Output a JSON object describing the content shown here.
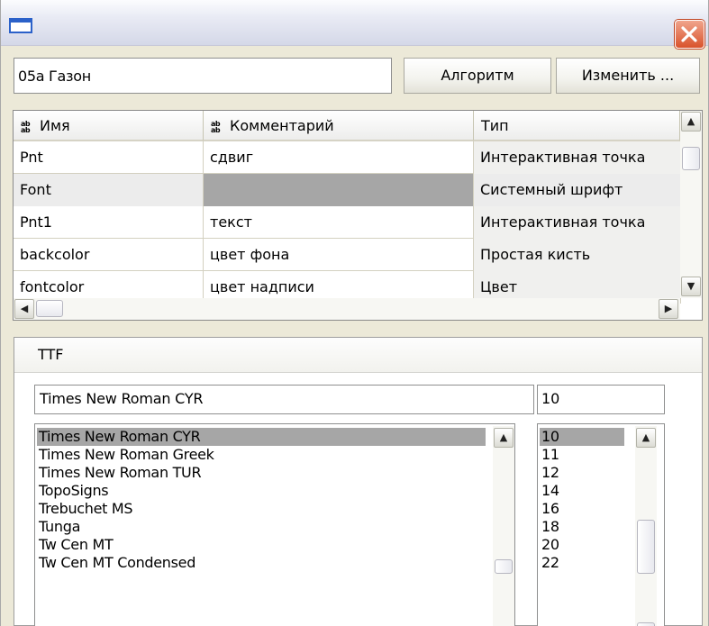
{
  "window": {
    "close_icon": "close-x-icon",
    "app_icon": "window-icon"
  },
  "toolbar": {
    "object_name": "05а Газон",
    "algorithm_label": "Алгоритм",
    "change_label": "Изменить ..."
  },
  "grid": {
    "headers": {
      "name": "Имя",
      "comment": "Комментарий",
      "type": "Тип"
    },
    "header_icon": "ab-field-icon",
    "rows": [
      {
        "name": "Pnt",
        "comment": "сдвиг",
        "type": "Интерактивная точка"
      },
      {
        "name": "Font",
        "comment": "",
        "type": "Системный шрифт"
      },
      {
        "name": "Pnt1",
        "comment": "текст",
        "type": "Интерактивная точка"
      },
      {
        "name": "backcolor",
        "comment": "цвет фона",
        "type": "Простая кисть"
      },
      {
        "name": "fontcolor",
        "comment": "цвет надписи",
        "type": "Цвет"
      }
    ],
    "selected_row": 1
  },
  "font_panel": {
    "tab_label": "TTF",
    "font_value": "Times New Roman CYR",
    "size_value": "10",
    "fonts": [
      "Times New Roman CYR",
      "Times New Roman Greek",
      "Times New Roman TUR",
      "TopoSigns",
      "Trebuchet MS",
      "Tunga",
      "Tw Cen MT",
      "Tw Cen MT Condensed"
    ],
    "sizes": [
      "10",
      "11",
      "12",
      "14",
      "16",
      "18",
      "20",
      "22"
    ],
    "selected_font": 0,
    "selected_size": 0
  },
  "colors": {
    "selection": "#a6a6a6",
    "close_button": "#d9532c",
    "face": "#ece9d8"
  }
}
